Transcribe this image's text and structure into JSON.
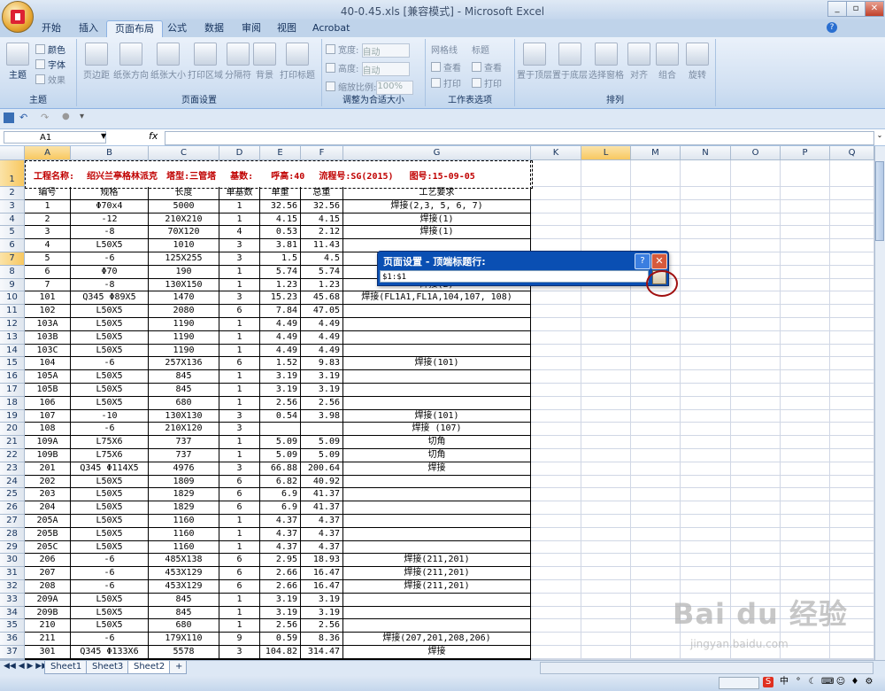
{
  "window": {
    "title": "40-0.45.xls  [兼容模式] - Microsoft Excel",
    "controls": [
      "_",
      "▫",
      "✕"
    ]
  },
  "ribbon": {
    "tabs": [
      "开始",
      "插入",
      "页面布局",
      "公式",
      "数据",
      "审阅",
      "视图",
      "Acrobat"
    ],
    "active_tab": "页面布局",
    "groups": {
      "theme": {
        "label": "主题",
        "theme_btn": "主题",
        "colors": "颜色",
        "fonts": "字体",
        "effects": "效果"
      },
      "page_setup": {
        "label": "页面设置",
        "buttons": [
          "页边距",
          "纸张方向",
          "纸张大小",
          "打印区域",
          "分隔符",
          "背景",
          "打印标题"
        ]
      },
      "scale": {
        "label": "调整为合适大小",
        "width_label": "宽度:",
        "width_value": "自动",
        "height_label": "高度:",
        "height_value": "自动",
        "scale_label": "缩放比例:",
        "scale_value": "100%"
      },
      "sheet_options": {
        "label": "工作表选项",
        "gridlines": "网格线",
        "headings": "标题",
        "view1": "查看",
        "view2": "查看",
        "print1": "打印",
        "print2": "打印"
      },
      "arrange": {
        "label": "排列",
        "buttons": [
          "置于顶层",
          "置于底层",
          "选择窗格",
          "对齐",
          "组合",
          "旋转"
        ]
      }
    }
  },
  "formula_bar": {
    "name_box": "A1",
    "fx": "fx",
    "value": ""
  },
  "columns": [
    "A",
    "B",
    "C",
    "D",
    "E",
    "F",
    "G",
    "K",
    "L",
    "M",
    "N",
    "O",
    "P",
    "Q"
  ],
  "row1": {
    "project_label": "工程名称:",
    "project_value": "绍兴兰亭格林派克",
    "tower_label": "塔型:",
    "tower_value": "三管塔",
    "base_label": "基数:",
    "height_label": "呼高:",
    "height_value": "40",
    "flow_label": "流程号:",
    "flow_value": "SG(2015)",
    "drawing_label": "图号:",
    "drawing_value": "15-09-05"
  },
  "table_headers": [
    "编号",
    "规格",
    "长度",
    "单基数",
    "单重",
    "总重",
    "工艺要求"
  ],
  "rows": [
    [
      "1",
      "Φ70x4",
      "5000",
      "1",
      "32.56",
      "32.56",
      "焊接(2,3, 5, 6, 7)"
    ],
    [
      "2",
      "-12",
      "210X210",
      "1",
      "4.15",
      "4.15",
      "焊接(1)"
    ],
    [
      "3",
      "-8",
      "70X120",
      "4",
      "0.53",
      "2.12",
      "焊接(1)"
    ],
    [
      "4",
      "L50X5",
      "1010",
      "3",
      "3.81",
      "11.43",
      ""
    ],
    [
      "5",
      "-6",
      "125X255",
      "3",
      "1.5",
      "4.5",
      ""
    ],
    [
      "6",
      "Φ70",
      "190",
      "1",
      "5.74",
      "5.74",
      ""
    ],
    [
      "7",
      "-8",
      "130X150",
      "1",
      "1.23",
      "1.23",
      "焊接(2)"
    ],
    [
      "101",
      "Q345 Φ89X5",
      "1470",
      "3",
      "15.23",
      "45.68",
      "焊接(FL1A1,FL1A,104,107, 108)"
    ],
    [
      "102",
      "L50X5",
      "2080",
      "6",
      "7.84",
      "47.05",
      ""
    ],
    [
      "103A",
      "L50X5",
      "1190",
      "1",
      "4.49",
      "4.49",
      ""
    ],
    [
      "103B",
      "L50X5",
      "1190",
      "1",
      "4.49",
      "4.49",
      ""
    ],
    [
      "103C",
      "L50X5",
      "1190",
      "1",
      "4.49",
      "4.49",
      ""
    ],
    [
      "104",
      "-6",
      "257X136",
      "6",
      "1.52",
      "9.83",
      "焊接(101)"
    ],
    [
      "105A",
      "L50X5",
      "845",
      "1",
      "3.19",
      "3.19",
      ""
    ],
    [
      "105B",
      "L50X5",
      "845",
      "1",
      "3.19",
      "3.19",
      ""
    ],
    [
      "106",
      "L50X5",
      "680",
      "1",
      "2.56",
      "2.56",
      ""
    ],
    [
      "107",
      "-10",
      "130X130",
      "3",
      "0.54",
      "3.98",
      "焊接(101)"
    ],
    [
      "108",
      "-6",
      "210X120",
      "3",
      "",
      "",
      "焊接 (107)"
    ],
    [
      "109A",
      "L75X6",
      "737",
      "1",
      "5.09",
      "5.09",
      "切角"
    ],
    [
      "109B",
      "L75X6",
      "737",
      "1",
      "5.09",
      "5.09",
      "切角"
    ],
    [
      "201",
      "Q345  Φ114X5",
      "4976",
      "3",
      "66.88",
      "200.64",
      "焊接"
    ],
    [
      "202",
      "L50X5",
      "1809",
      "6",
      "6.82",
      "40.92",
      ""
    ],
    [
      "203",
      "L50X5",
      "1829",
      "6",
      "6.9",
      "41.37",
      ""
    ],
    [
      "204",
      "L50X5",
      "1829",
      "6",
      "6.9",
      "41.37",
      ""
    ],
    [
      "205A",
      "L50X5",
      "1160",
      "1",
      "4.37",
      "4.37",
      ""
    ],
    [
      "205B",
      "L50X5",
      "1160",
      "1",
      "4.37",
      "4.37",
      ""
    ],
    [
      "205C",
      "L50X5",
      "1160",
      "1",
      "4.37",
      "4.37",
      ""
    ],
    [
      "206",
      "-6",
      "485X138",
      "6",
      "2.95",
      "18.93",
      "焊接(211,201)"
    ],
    [
      "207",
      "-6",
      "453X129",
      "6",
      "2.66",
      "16.47",
      "焊接(211,201)"
    ],
    [
      "208",
      "-6",
      "453X129",
      "6",
      "2.66",
      "16.47",
      "焊接(211,201)"
    ],
    [
      "209A",
      "L50X5",
      "845",
      "1",
      "3.19",
      "3.19",
      ""
    ],
    [
      "209B",
      "L50X5",
      "845",
      "1",
      "3.19",
      "3.19",
      ""
    ],
    [
      "210",
      "L50X5",
      "680",
      "1",
      "2.56",
      "2.56",
      ""
    ],
    [
      "211",
      "-6",
      "179X110",
      "9",
      "0.59",
      "8.36",
      "焊接(207,201,208,206)"
    ],
    [
      "301",
      "Q345  Φ133X6",
      "5578",
      "3",
      "104.82",
      "314.47",
      "焊接"
    ]
  ],
  "dialog": {
    "title": "页面设置 - 顶端标题行:",
    "help": "?",
    "close": "✕",
    "value": "$1:$1"
  },
  "sheets": [
    "Sheet1",
    "Sheet3",
    "Sheet2"
  ],
  "active_sheet": "Sheet2",
  "watermark": {
    "brand": "Bai du 经验",
    "url": "jingyan.baidu.com"
  }
}
